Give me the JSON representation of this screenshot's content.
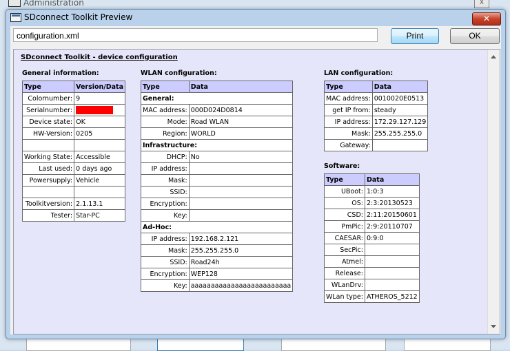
{
  "background_window": {
    "title": "Administration"
  },
  "dialog": {
    "title": "SDconnect Toolkit Preview",
    "close_label": "✕",
    "path_value": "configuration.xml",
    "print_label": "Print",
    "ok_label": "OK"
  },
  "doc": {
    "title": "SDconnect Toolkit - device configuration",
    "general": {
      "title": "General information:",
      "col_type": "Type",
      "col_data": "Version/Data",
      "rows": [
        {
          "k": "Colornumber:",
          "v": "9"
        },
        {
          "k": "Serialnumber:",
          "v": ""
        },
        {
          "k": "Device state:",
          "v": "OK"
        },
        {
          "k": "HW-Version:",
          "v": "0205"
        },
        {
          "k": "",
          "v": ""
        },
        {
          "k": "Working State:",
          "v": "Accessible"
        },
        {
          "k": "Last used:",
          "v": "0 days ago"
        },
        {
          "k": "Powersupply:",
          "v": "Vehicle"
        },
        {
          "k": "",
          "v": ""
        },
        {
          "k": "Toolkitversion:",
          "v": "2.1.13.1"
        },
        {
          "k": "Tester:",
          "v": "Star-PC"
        }
      ]
    },
    "wlan": {
      "title": "WLAN configuration:",
      "col_type": "Type",
      "col_data": "Data",
      "general_label": "General:",
      "general_rows": [
        {
          "k": "MAC address:",
          "v": "000D024D0814"
        },
        {
          "k": "Mode:",
          "v": "Road WLAN"
        },
        {
          "k": "Region:",
          "v": "WORLD"
        }
      ],
      "infra_label": "Infrastructure:",
      "infra_rows": [
        {
          "k": "DHCP:",
          "v": "No"
        },
        {
          "k": "IP address:",
          "v": ""
        },
        {
          "k": "Mask:",
          "v": ""
        },
        {
          "k": "SSID:",
          "v": ""
        },
        {
          "k": "Encryption:",
          "v": ""
        },
        {
          "k": "Key:",
          "v": ""
        }
      ],
      "adhoc_label": "Ad-Hoc:",
      "adhoc_rows": [
        {
          "k": "IP address:",
          "v": "192.168.2.121"
        },
        {
          "k": "Mask:",
          "v": "255.255.255.0"
        },
        {
          "k": "SSID:",
          "v": "Road24h"
        },
        {
          "k": "Encryption:",
          "v": "WEP128"
        },
        {
          "k": "Key:",
          "v": "aaaaaaaaaaaaaaaaaaaaaaaaa"
        }
      ]
    },
    "lan": {
      "title": "LAN configuration:",
      "col_type": "Type",
      "col_data": "Data",
      "rows": [
        {
          "k": "MAC address:",
          "v": "0010020E0513"
        },
        {
          "k": "get IP from:",
          "v": "steady"
        },
        {
          "k": "IP address:",
          "v": "172.29.127.129"
        },
        {
          "k": "Mask:",
          "v": "255.255.255.0"
        },
        {
          "k": "Gateway:",
          "v": ""
        }
      ]
    },
    "software": {
      "title": "Software:",
      "col_type": "Type",
      "col_data": "Data",
      "rows": [
        {
          "k": "UBoot:",
          "v": "1:0:3"
        },
        {
          "k": "OS:",
          "v": "2:3:20130523"
        },
        {
          "k": "CSD:",
          "v": "2:11:20150601"
        },
        {
          "k": "PmPic:",
          "v": "2:9:20110707"
        },
        {
          "k": "CAESAR:",
          "v": "0:9:0"
        },
        {
          "k": "SecPic:",
          "v": ""
        },
        {
          "k": "Atmel:",
          "v": ""
        },
        {
          "k": "Release:",
          "v": ""
        },
        {
          "k": "WLanDrv:",
          "v": ""
        },
        {
          "k": "WLan type:",
          "v": "ATHEROS_5212"
        }
      ]
    }
  }
}
